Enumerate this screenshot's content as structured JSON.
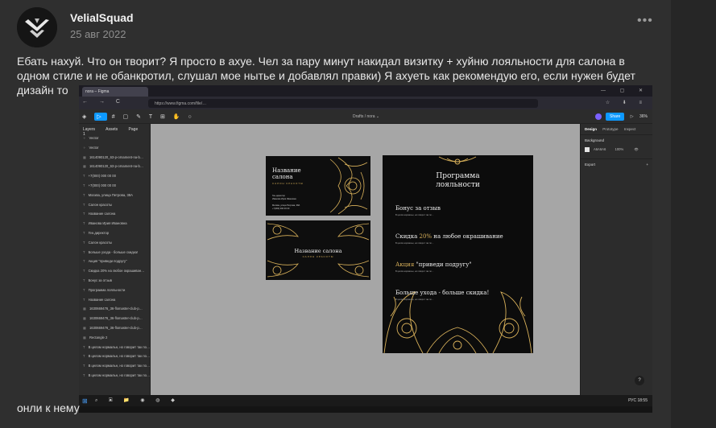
{
  "post": {
    "author": "VelialSquad",
    "date": "25 авг 2022",
    "more": "•••",
    "text": "Ебать нахуй. Что он творит? Я просто в ахуе. Чел за пару минут накидал визитку + хуйню лояльности для салона в одном стиле и не обанкротил, слушал мое нытье и добавлял правки) Я ахуеть как рекомендую его, если нужен будет дизайн то",
    "footer": "онли к нему"
  },
  "browser": {
    "tab_title": "nora – Figma",
    "url": "https://www.figma.com/file/…",
    "nav": "←  →  C",
    "tb_icons": "☆ ⬇ ≡"
  },
  "figma": {
    "file_title": "Drafts / nora ⌄",
    "share_label": "Share",
    "zoom": "36%",
    "layers_tabs": [
      "Layers",
      "Assets",
      "Page 1"
    ],
    "layers": [
      "Vector",
      "Vector",
      "1614090120_63-p-ornament-na-b…",
      "1614090120_63-p-ornament-na-b…",
      "+7(000) 000 00 00",
      "+7(000) 000 00 00",
      "Москва, улица Петрова, 38А",
      "Салон красоты",
      "Название салона",
      "Иванова Ирия Ивановна",
      "Ген.директор",
      "Салон красоты",
      "Больше ухода - больше скидка!",
      "Акция \"приведи подругу\"",
      "Скидка 20% на любое окрашиван…",
      "Бонус за отзыв",
      "Программа лояльности",
      "Название салона",
      "1630669476_36-flomaster-club-p…",
      "1630669476_36-flomaster-club-p…",
      "1630669476_36-flomaster-club-p…",
      "Rectangle 2",
      "В целом нормальн, но говорит так по…",
      "В целом нормальн, но говорит так по…",
      "В целом нормальн, но говорит так по…",
      "В целом нормальн, но говорит так по…"
    ],
    "props": {
      "tabs": [
        "Design",
        "Prototype",
        "Inspect"
      ],
      "background_label": "Background",
      "bg_hex": "A6A6A6",
      "bg_opacity": "100%",
      "export_label": "Export",
      "plus": "+"
    },
    "help": "?"
  },
  "design": {
    "card_name": "Название салона",
    "card_sub": "САЛОН КРАСОТЫ",
    "card_info": "Ген.директор\nИванова Ирия Ивановна\n\nМосква, улица Петрова, 38А\n+7(000) 000 00 00",
    "poster_title": "Программа лояльности",
    "poster_h1": "Бонус за отзыв",
    "poster_h2_a": "Скидка ",
    "poster_h2_b": "20%",
    "poster_h2_c": " на любое окрашивание",
    "poster_h3_a": "Акция ",
    "poster_h3_b": "\"приведи подругу\"",
    "poster_h4": "Больше ухода - больше скидка!",
    "poster_body": "В целом нормальн, но говорит так по…"
  },
  "taskbar": {
    "tray": "РУС  18:55"
  },
  "colors": {
    "gold": "#d9b15a",
    "figma_blue": "#0d99ff",
    "canvas": "#a6a6a6"
  }
}
